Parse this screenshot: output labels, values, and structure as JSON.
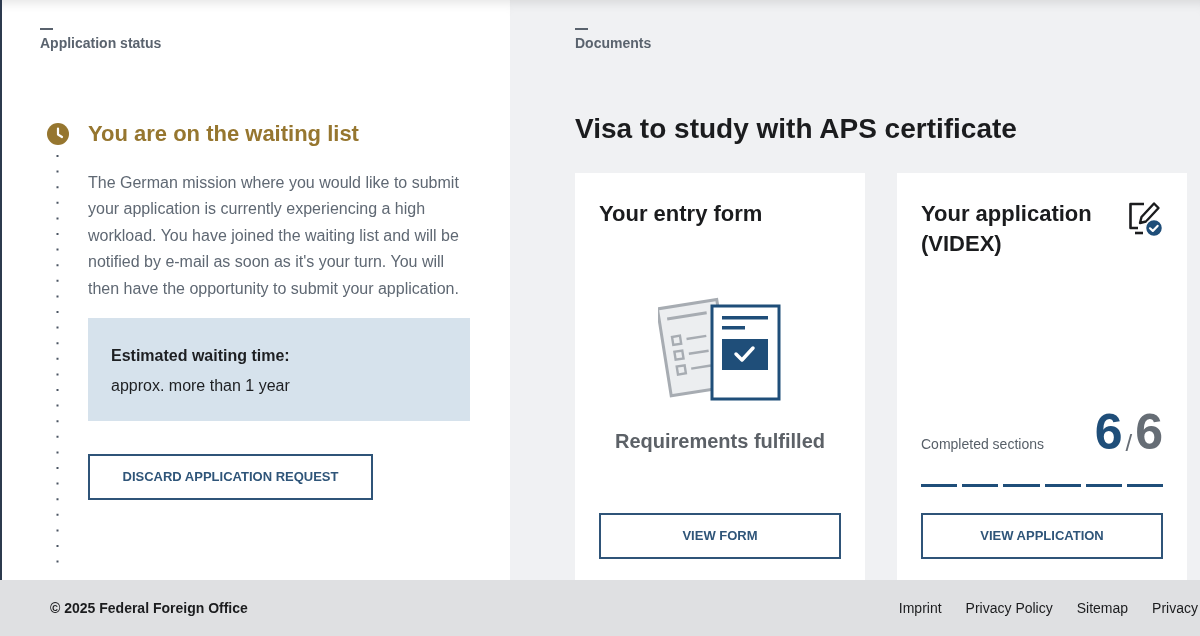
{
  "status_panel": {
    "section_label": "Application status",
    "title": "You are on the waiting list",
    "description": "The German mission where you would like to submit your application is currently experiencing a high workload. You have joined the waiting list and will be notified by e-mail as soon as it's your turn. You will then have the opportunity to submit your application.",
    "estimate": {
      "label": "Estimated waiting time:",
      "value": "approx. more than 1 year"
    },
    "button": "DISCARD APPLICATION REQUEST"
  },
  "documents_panel": {
    "section_label": "Documents",
    "heading": "Visa to study with APS certificate",
    "cards": [
      {
        "kind": "form",
        "title": "Your entry form",
        "status_text": "Requirements fulfilled",
        "button": "VIEW FORM"
      },
      {
        "kind": "application",
        "title": "Your application (VIDEX)",
        "progress_label": "Completed sections",
        "completed": "6",
        "separator": "/",
        "total": "6",
        "sections": [
          {
            "completed": true
          },
          {
            "completed": true
          },
          {
            "completed": true
          },
          {
            "completed": true
          },
          {
            "completed": true
          },
          {
            "completed": true
          }
        ],
        "button": "VIEW APPLICATION"
      }
    ]
  },
  "footer": {
    "copyright": "© 2025 Federal Foreign Office",
    "links": [
      "Imprint",
      "Privacy Policy",
      "Sitemap",
      "Privacy"
    ]
  }
}
